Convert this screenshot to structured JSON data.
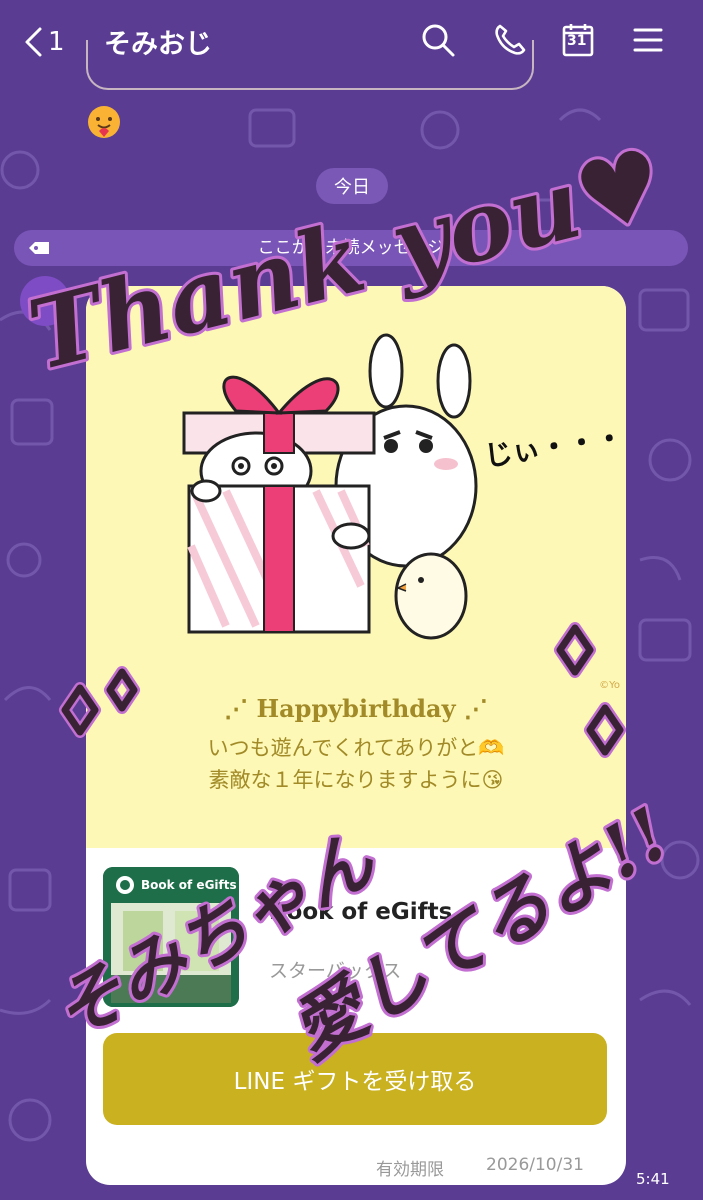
{
  "header": {
    "back_count": "1",
    "title": "そみおじ",
    "icons": [
      "search-icon",
      "phone-icon",
      "calendar-icon",
      "menu-icon"
    ],
    "calendar_day": "31"
  },
  "chat": {
    "date_label": "今日",
    "unread_label": "ここから未読メッセージ"
  },
  "card": {
    "sticker_text": "じぃ・・・",
    "copyright": "©Yo",
    "message_line1": "⋰ Happybirthday ⋰",
    "message_line2": "いつも遊んでくれてありがと🫶",
    "message_line3": "素敵な１年になりますように😘",
    "gift_thumb_label": "Book of eGifts",
    "gift_name": "Book of eGifts",
    "gift_shop": "スターバックス",
    "receive_button": "LINE ギフトを受け取る",
    "expiry_label": "有効期限",
    "expiry_date": "2026/10/31"
  },
  "time": "5:41",
  "overlay": {
    "text1": "Thank you♥",
    "text2": "そみちゃん",
    "text3": "愛してるよ!!"
  },
  "colors": {
    "background": "#5a3d92",
    "unread_bar": "#7a55b8",
    "card_top": "#fdf8b6",
    "button": "#c9b11f",
    "message_text": "#a18a27",
    "ribbon": "#ec3f78"
  }
}
